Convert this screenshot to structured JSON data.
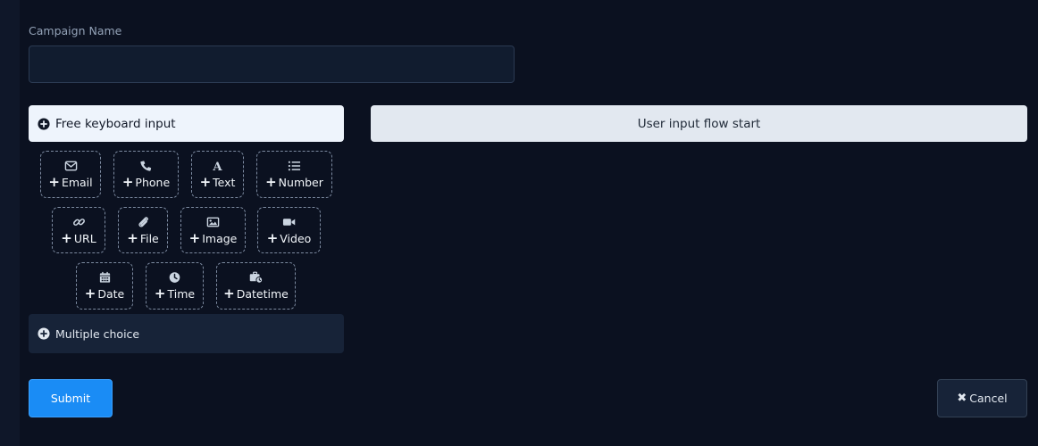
{
  "form": {
    "campaign_name_label": "Campaign Name",
    "campaign_name_value": "",
    "campaign_name_placeholder": ""
  },
  "sections": {
    "free_keyboard_label": "Free keyboard input",
    "multiple_choice_label": "Multiple choice"
  },
  "flow": {
    "start_label": "User input flow start"
  },
  "input_types": [
    {
      "label": "Email",
      "icon": "envelope-icon"
    },
    {
      "label": "Phone",
      "icon": "phone-icon"
    },
    {
      "label": "Text",
      "icon": "font-icon"
    },
    {
      "label": "Number",
      "icon": "list-ol-icon"
    },
    {
      "label": "URL",
      "icon": "link-icon"
    },
    {
      "label": "File",
      "icon": "paperclip-icon"
    },
    {
      "label": "Image",
      "icon": "image-icon"
    },
    {
      "label": "Video",
      "icon": "video-icon"
    },
    {
      "label": "Date",
      "icon": "calendar-icon"
    },
    {
      "label": "Time",
      "icon": "clock-icon"
    },
    {
      "label": "Datetime",
      "icon": "business-time-icon"
    }
  ],
  "actions": {
    "submit_label": "Submit",
    "cancel_label": "Cancel"
  },
  "colors": {
    "background": "#0b1120",
    "accent": "#1a8cf5",
    "section_active": "#eef4fc",
    "section_inactive": "#172338"
  }
}
